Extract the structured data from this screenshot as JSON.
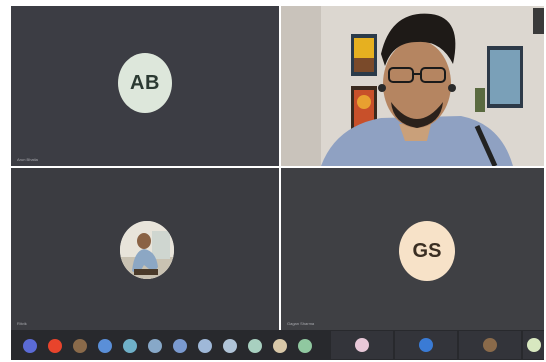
{
  "tiles": {
    "tile1": {
      "initials": "AB",
      "name": "Arun Bhatia"
    },
    "tile3": {
      "name": "Ritvik"
    },
    "tile4": {
      "initials": "GS",
      "name": "Gagan Sharma"
    }
  },
  "strip": {
    "avatar_colors": [
      "#5b6bd6",
      "#e8442c",
      "#8a6a4a",
      "#5a8fd8",
      "#6fb0c8",
      "#87a8c8",
      "#7a9ad0",
      "#9fb8d8",
      "#b0c4d8",
      "#a8d0c0",
      "#d8c8a8",
      "#90c8a0"
    ],
    "mini_tiles": [
      {
        "dot_color": "#e8c8d8"
      },
      {
        "dot_color": "#3a7bd5"
      },
      {
        "dot_color": "#8a6a4a"
      },
      {
        "dot_color": "#d8e8c0"
      }
    ]
  },
  "colors": {
    "tile_bg": "#3c3d44",
    "ab_avatar": "#dde7db",
    "gs_avatar": "#f7e2c8"
  }
}
